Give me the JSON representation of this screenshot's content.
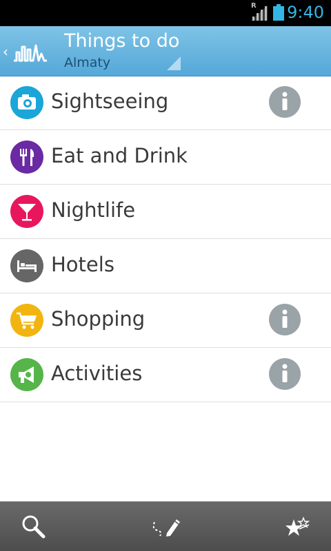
{
  "status_bar": {
    "time": "9:40",
    "roaming_indicator": "R",
    "icons": [
      "signal-icon",
      "battery-icon"
    ]
  },
  "action_bar": {
    "title": "Things to do",
    "subtitle": "Almaty",
    "icons": [
      "back-chevron-icon",
      "app-logo-icon",
      "spinner-dropdown-icon"
    ]
  },
  "categories": [
    {
      "label": "Sightseeing",
      "icon": "camera-icon",
      "color": "#1aa6d8",
      "info": true
    },
    {
      "label": "Eat and Drink",
      "icon": "fork-knife-icon",
      "color": "#6a2aa3",
      "info": false
    },
    {
      "label": "Nightlife",
      "icon": "cocktail-icon",
      "color": "#e8175d",
      "info": false
    },
    {
      "label": "Hotels",
      "icon": "bed-icon",
      "color": "#666666",
      "info": false
    },
    {
      "label": "Shopping",
      "icon": "cart-icon",
      "color": "#f2b40f",
      "info": true
    },
    {
      "label": "Activities",
      "icon": "megaphone-icon",
      "color": "#55b548",
      "info": true
    }
  ],
  "bottom_bar": {
    "buttons": [
      "search-icon",
      "route-draw-icon",
      "favorites-stars-icon"
    ]
  },
  "colors": {
    "action_bar": "#6ab6e0",
    "accent_clock": "#33b5e5",
    "info_icon": "#9aa3a8",
    "bottom_bar": "#555555"
  }
}
